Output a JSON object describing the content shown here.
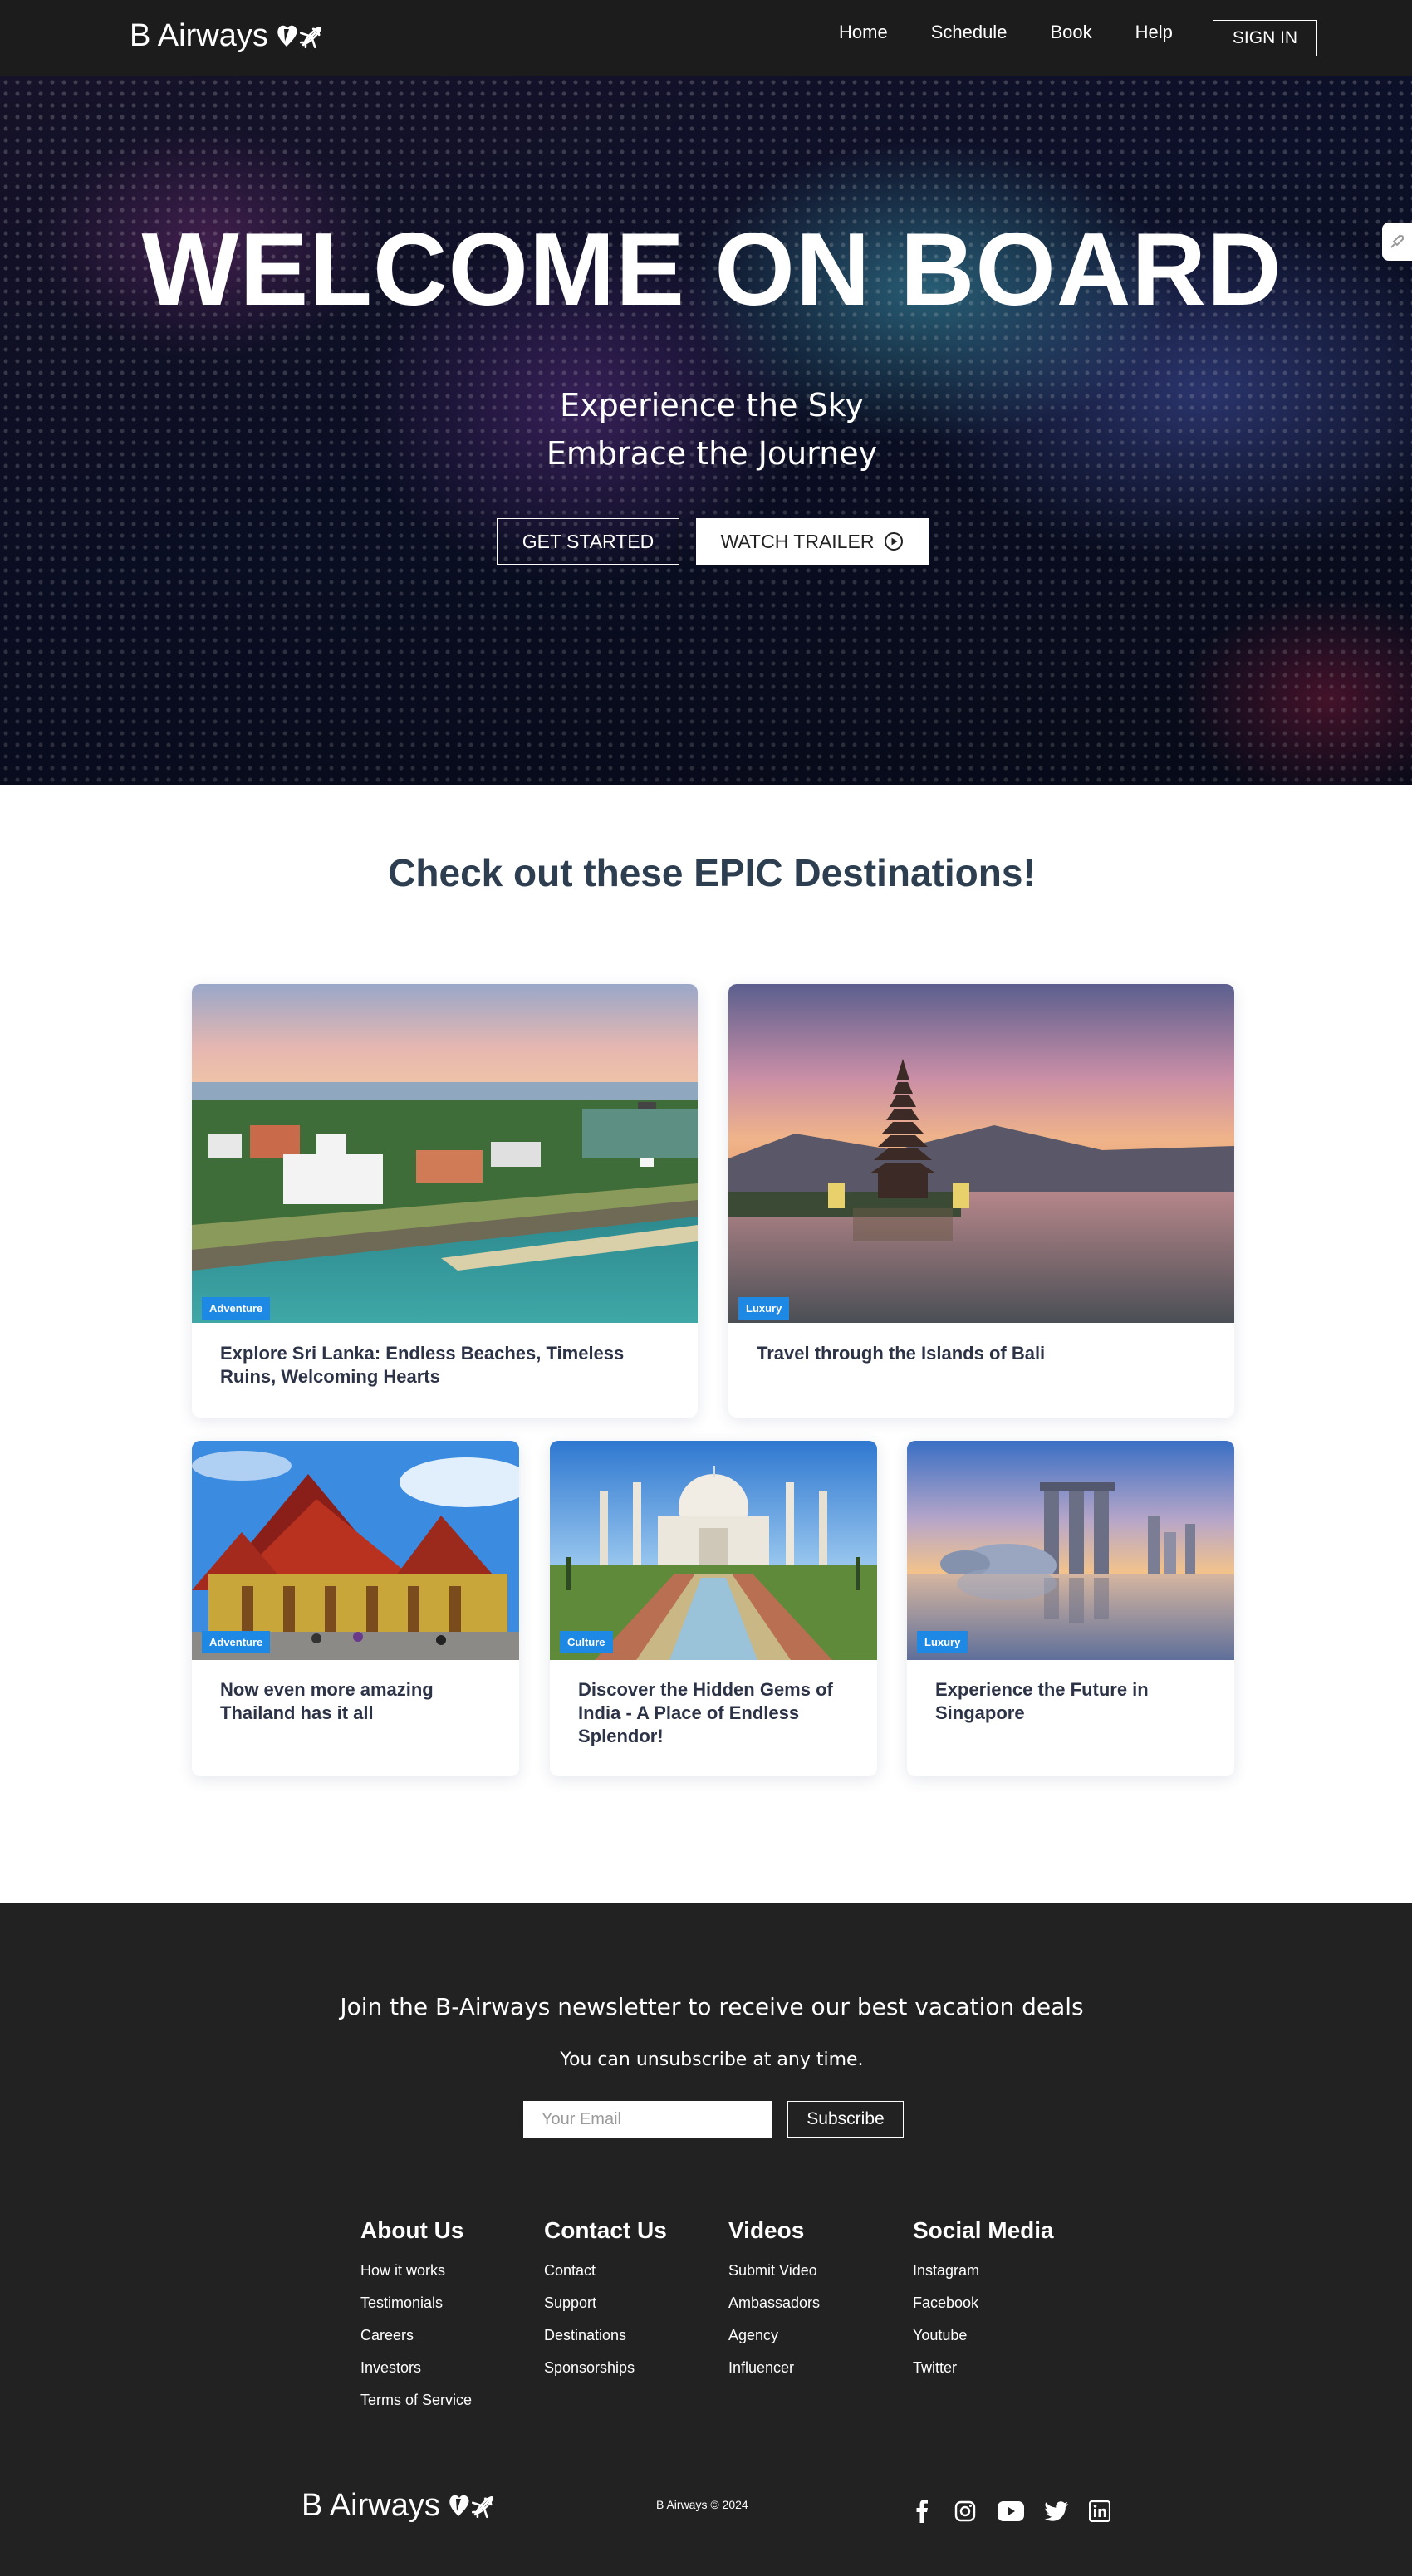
{
  "nav": {
    "brand": "B Airways",
    "links": [
      {
        "label": "Home"
      },
      {
        "label": "Schedule"
      },
      {
        "label": "Book"
      },
      {
        "label": "Help"
      }
    ],
    "signin_label": "SIGN IN"
  },
  "hero": {
    "title": "WELCOME ON BOARD",
    "subtitle_line1": "Experience the Sky",
    "subtitle_line2": "Embrace the Journey",
    "get_started_label": "GET STARTED",
    "watch_trailer_label": "WATCH TRAILER"
  },
  "destinations": {
    "heading": "Check out these EPIC Destinations!",
    "cards": [
      {
        "badge": "Adventure",
        "title": "Explore Sri Lanka: Endless Beaches, Timeless Ruins, Welcoming Hearts",
        "image": "sri-lanka-coast"
      },
      {
        "badge": "Luxury",
        "title": "Travel through the Islands of Bali",
        "image": "bali-temple"
      },
      {
        "badge": "Adventure",
        "title": "Now even more amazing Thailand has it all",
        "image": "thailand-temple"
      },
      {
        "badge": "Culture",
        "title": "Discover the Hidden Gems of India - A Place of Endless Splendor!",
        "image": "taj-mahal"
      },
      {
        "badge": "Luxury",
        "title": "Experience the Future in Singapore",
        "image": "singapore-skyline"
      }
    ]
  },
  "newsletter": {
    "title": "Join the B-Airways newsletter to receive our best vacation deals",
    "subtitle": "You can unsubscribe at any time.",
    "email_placeholder": "Your Email",
    "subscribe_label": "Subscribe"
  },
  "footer": {
    "columns": [
      {
        "heading": "About Us",
        "links": [
          "How it works",
          "Testimonials",
          "Careers",
          "Investors",
          "Terms of Service"
        ]
      },
      {
        "heading": "Contact Us",
        "links": [
          "Contact",
          "Support",
          "Destinations",
          "Sponsorships"
        ]
      },
      {
        "heading": "Videos",
        "links": [
          "Submit Video",
          "Ambassadors",
          "Agency",
          "Influencer"
        ]
      },
      {
        "heading": "Social Media",
        "links": [
          "Instagram",
          "Facebook",
          "Youtube",
          "Twitter"
        ]
      }
    ],
    "brand": "B Airways",
    "copyright": "B Airways © 2024",
    "social_icons": [
      "facebook-icon",
      "instagram-icon",
      "youtube-icon",
      "twitter-icon",
      "linkedin-icon"
    ]
  },
  "colors": {
    "nav_bg": "#1c1c1c",
    "footer_bg": "#222222",
    "heading": "#2d3e50",
    "badge": "#1e88e5"
  }
}
